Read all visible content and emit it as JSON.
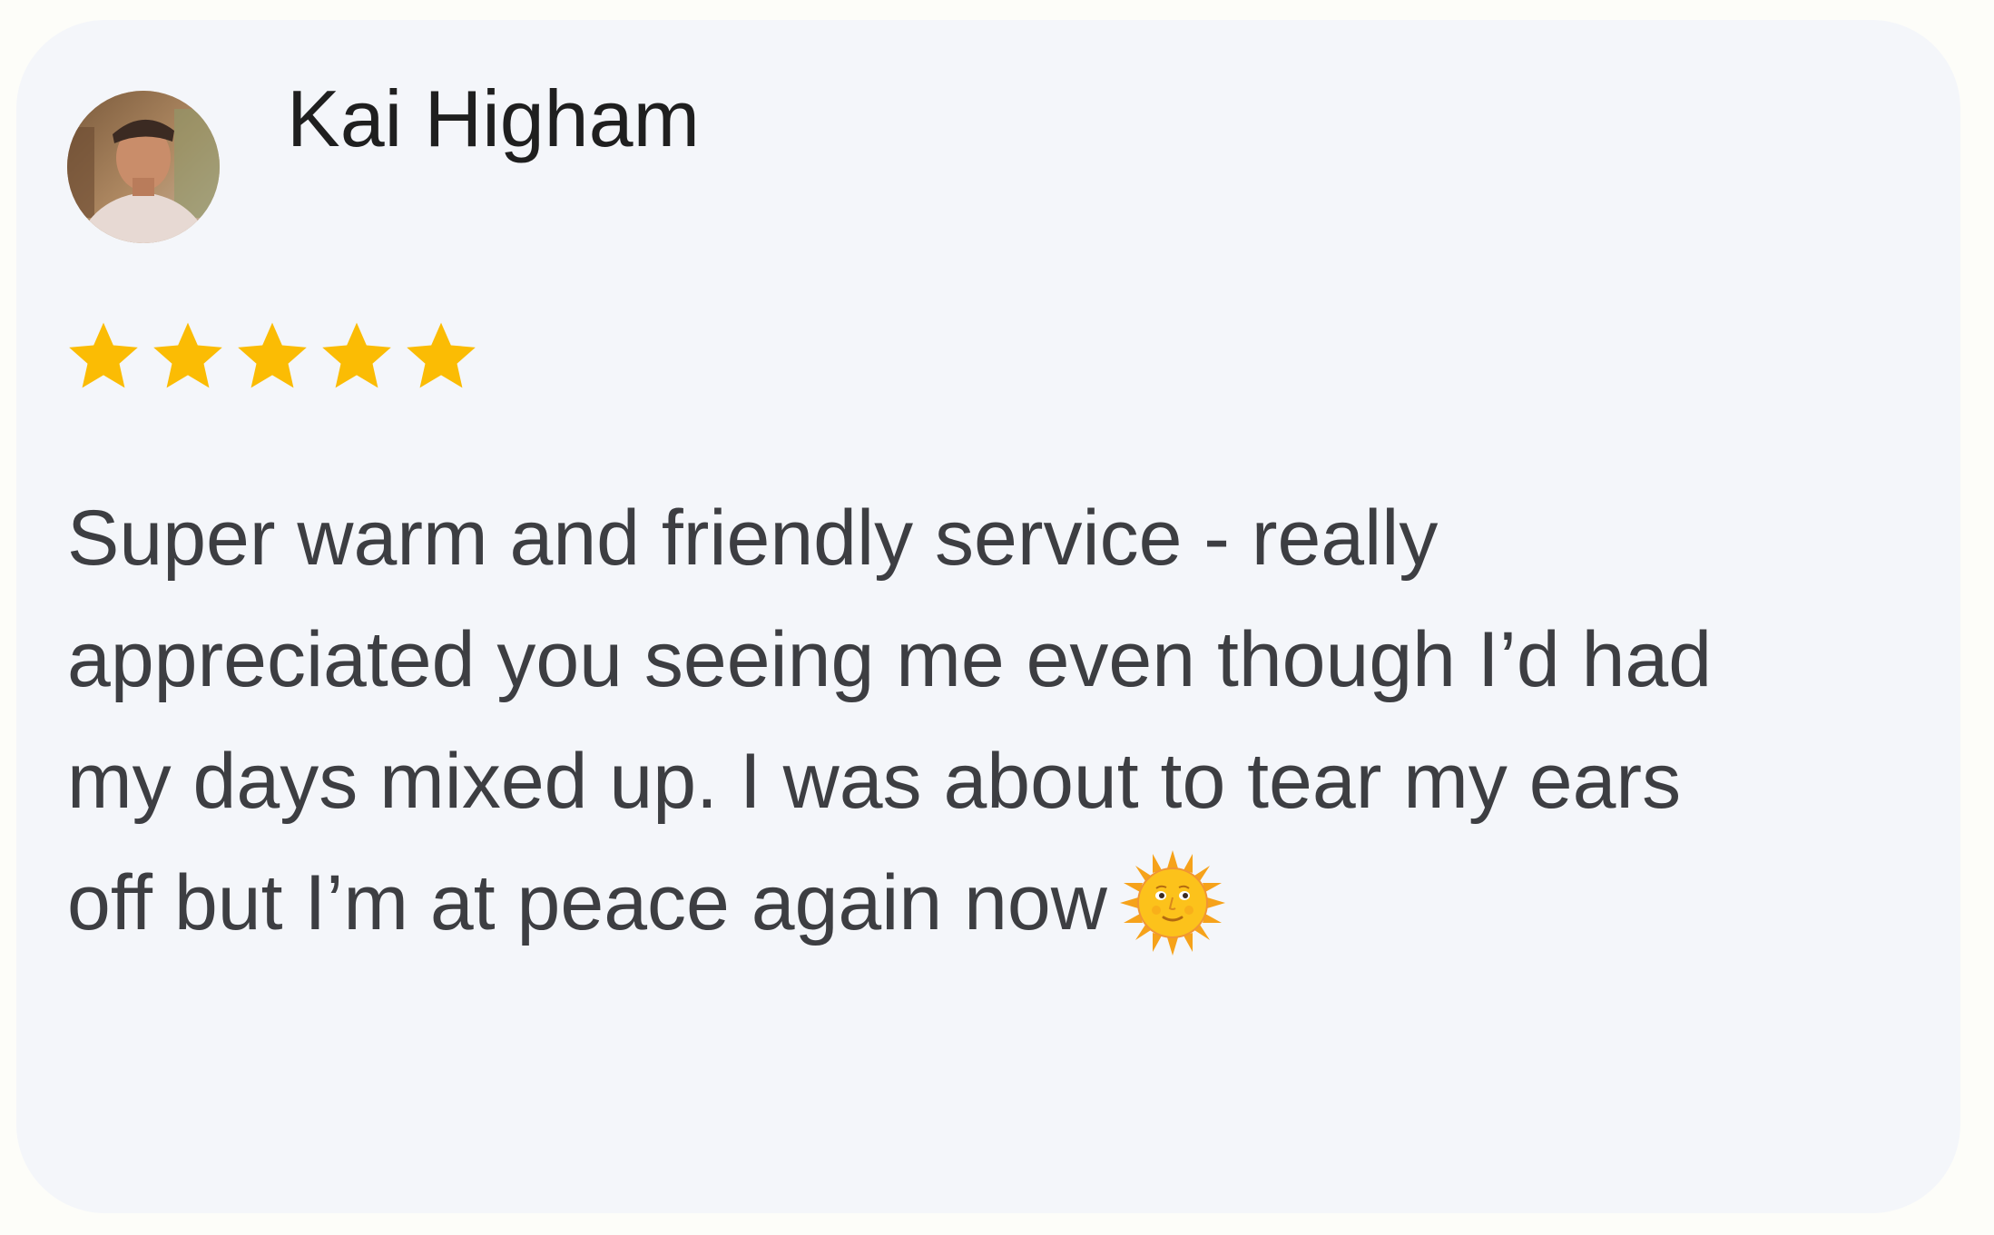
{
  "review": {
    "reviewer_name": "Kai Higham",
    "avatar_icon": "reviewer-photo",
    "rating": 5,
    "rating_max": 5,
    "text_lines": [
      "Super warm and friendly service - really",
      "appreciated you seeing me even though I’d had",
      "my days mixed up. I was about to tear my ears",
      "off but I’m at peace again now"
    ],
    "emoji": "sun-with-face-icon"
  },
  "colors": {
    "card_background": "#f4f6fa",
    "page_background": "#fdfdf9",
    "star_color": "#fbbc04",
    "name_color": "#1f1f1f",
    "text_color": "#3d3e42"
  }
}
